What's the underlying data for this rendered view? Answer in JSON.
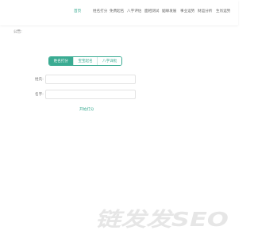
{
  "nav": {
    "items": [
      {
        "label": "首页",
        "active": true
      },
      {
        "label": "姓名打分",
        "active": false
      },
      {
        "label": "免费起名",
        "active": false
      },
      {
        "label": "八字评估",
        "active": false
      },
      {
        "label": "面相测试",
        "active": false
      },
      {
        "label": "姻缘发展",
        "active": false
      },
      {
        "label": "事业运势",
        "active": false
      },
      {
        "label": "财运分析",
        "active": false
      },
      {
        "label": "生肖运势",
        "active": false
      }
    ]
  },
  "notice": {
    "text": "公告:"
  },
  "tabs": [
    {
      "label": "姓名打分",
      "active": true
    },
    {
      "label": "宝宝起名",
      "active": false
    },
    {
      "label": "八字详批",
      "active": false
    }
  ],
  "form": {
    "surname_label": "姓氏:",
    "surname_value": "",
    "name_label": "名字:",
    "name_value": "",
    "submit_label": "开始打分"
  },
  "watermark": {
    "text": "链发发SEO"
  },
  "colors": {
    "accent": "#3aab92",
    "watermark": "#e6e6e6"
  }
}
